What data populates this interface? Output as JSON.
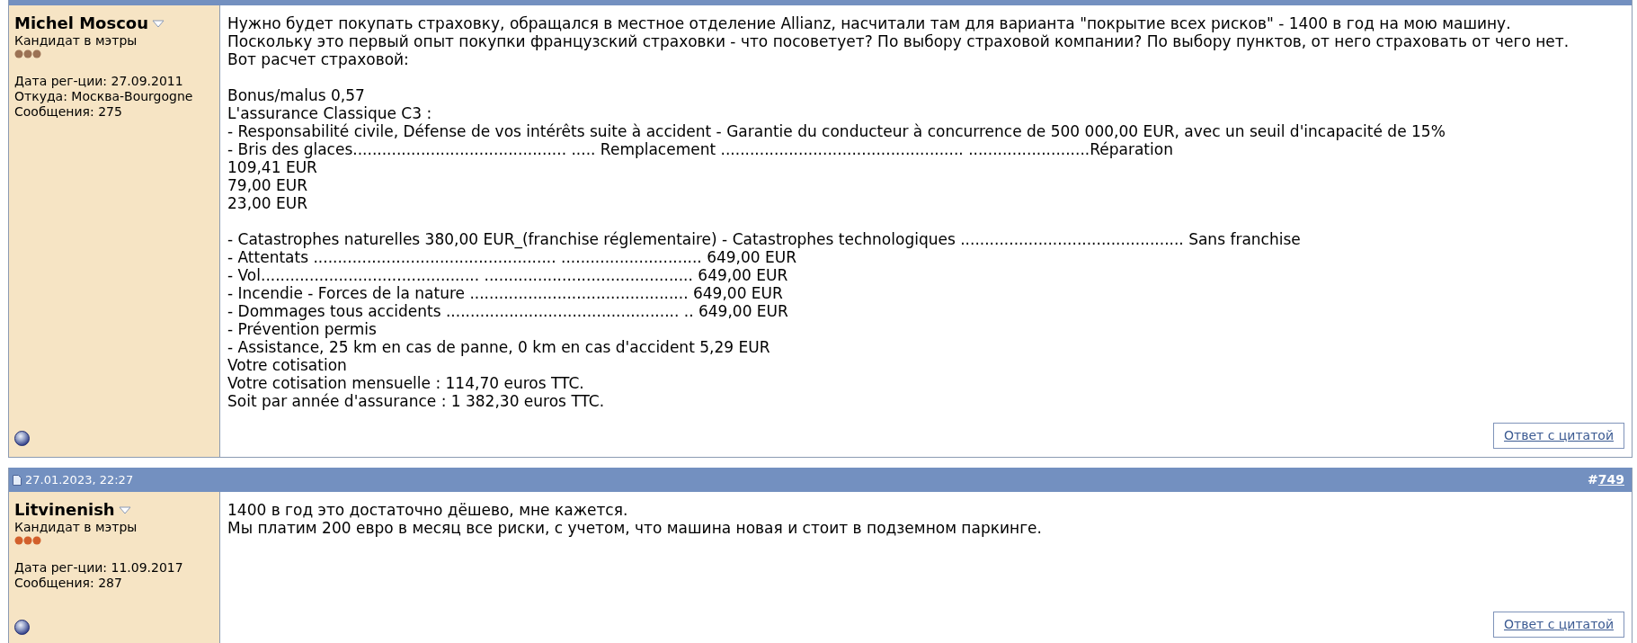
{
  "posts": [
    {
      "author": {
        "name": "Michel Moscou",
        "rank": "Кандидат в мэтры",
        "reputation": {
          "color": "#9b7255"
        },
        "details": [
          "Дата рег-ции: 27.09.2011",
          "Откуда: Москва-Bourgogne",
          "Сообщения: 275"
        ]
      },
      "body": [
        [
          "Нужно будет покупать страховку, обращался в местное отделение Allianz, насчитали там для варианта \"покрытие всех рисков\" - 1400 в год на мою машину.",
          "Поскольку это первый опыт покупки французский страховки - что посоветует? По выбору страховой компании? По выбору пунктов, от него страховать от чего нет.",
          "Вот расчет страховой:"
        ],
        [
          "Bonus/malus 0,57",
          "L'assurance Classique C3 :",
          "- Responsabilité civile, Défense de vos intérêts suite à accident - Garantie du conducteur à concurrence de 500 000,00 EUR, avec un seuil d'incapacité de 15%",
          "- Bris des glaces............................................ ..... Remplacement .................................................. .........................Réparation",
          "109,41 EUR",
          "79,00 EUR",
          "23,00 EUR"
        ],
        [
          "- Catastrophes naturelles 380,00 EUR_(franchise réglementaire) - Catastrophes technologiques .............................................. Sans franchise",
          "- Attentats .................................................. ............................. 649,00 EUR",
          "- Vol............................................. ........................................... 649,00 EUR",
          "- Incendie - Forces de la nature ............................................. 649,00 EUR",
          "- Dommages tous accidents ................................................ .. 649,00 EUR",
          "- Prévention permis",
          "- Assistance, 25 km en cas de panne, 0 km en cas d'accident 5,29 EUR",
          "Votre cotisation",
          "Votre cotisation mensuelle : 114,70 euros TTC.",
          "Soit par année d'assurance : 1 382,30 euros TTC."
        ]
      ],
      "reply_button": "Ответ с цитатой"
    },
    {
      "date": "27.01.2023, 22:27",
      "number": {
        "prefix": "#",
        "link": "749"
      },
      "author": {
        "name": "Litvinenish",
        "rank": "Кандидат в мэтры",
        "reputation": {
          "color": "#d2602c"
        },
        "details": [
          "Дата рег-ции: 11.09.2017",
          "Сообщения: 287"
        ]
      },
      "body": [
        [
          "1400 в год это достаточно дёшево, мне кажется.",
          "Мы платим 200 евро в месяц все риски, с учетом, что машина новая и стоит в подземном паркинге."
        ]
      ],
      "reply_button": "Ответ с цитатой"
    }
  ]
}
